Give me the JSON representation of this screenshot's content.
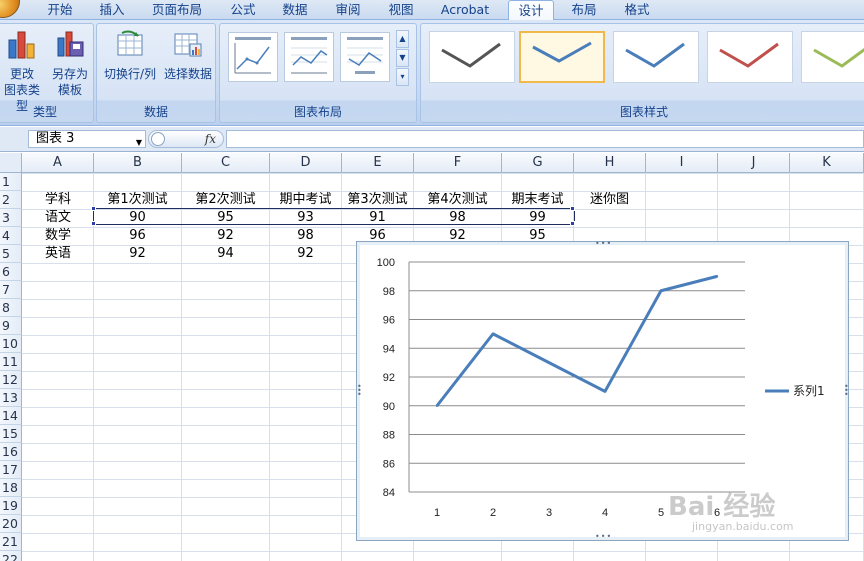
{
  "ribbon_tabs": [
    "开始",
    "插入",
    "页面布局",
    "公式",
    "数据",
    "审阅",
    "视图",
    "Acrobat",
    "设计",
    "布局",
    "格式"
  ],
  "active_tab": "设计",
  "ribbon": {
    "type_group": {
      "label": "类型",
      "change_type": [
        "更改",
        "图表类型"
      ],
      "save_template": [
        "另存为",
        "模板"
      ]
    },
    "data_group": {
      "label": "数据",
      "switch_row_col": "切换行/列",
      "select_data": "选择数据"
    },
    "layout_group": {
      "label": "图表布局"
    },
    "style_group": {
      "label": "图表样式"
    }
  },
  "formula_bar": {
    "name_box": "图表 3",
    "fx_label": "fx",
    "formula": ""
  },
  "columns": [
    "A",
    "B",
    "C",
    "D",
    "E",
    "F",
    "G",
    "H",
    "I",
    "J",
    "K"
  ],
  "rows": [
    "1",
    "2",
    "3",
    "4",
    "5",
    "6",
    "7",
    "8",
    "9",
    "10",
    "11",
    "12",
    "13",
    "14",
    "15",
    "16",
    "17",
    "18",
    "19",
    "20",
    "21",
    "22"
  ],
  "sheet": {
    "headers": [
      "学科",
      "第1次测试",
      "第2次测试",
      "期中考试",
      "第3次测试",
      "第4次测试",
      "期末考试",
      "迷你图"
    ],
    "rows": [
      {
        "subject": "语文",
        "scores": [
          "90",
          "95",
          "93",
          "91",
          "98",
          "99"
        ]
      },
      {
        "subject": "数学",
        "scores": [
          "96",
          "92",
          "98",
          "96",
          "92",
          "95"
        ]
      },
      {
        "subject": "英语",
        "scores": [
          "92",
          "94",
          "92",
          "",
          "",
          ""
        ]
      }
    ]
  },
  "chart_data": {
    "type": "line",
    "x": [
      1,
      2,
      3,
      4,
      5,
      6
    ],
    "series": [
      {
        "name": "系列1",
        "values": [
          90,
          95,
          93,
          91,
          98,
          99
        ],
        "color": "#4a7ebb"
      }
    ],
    "ylim": [
      84,
      100
    ],
    "yticks": [
      84,
      86,
      88,
      90,
      92,
      94,
      96,
      98,
      100
    ],
    "grid": true,
    "legend": "right"
  },
  "watermark": {
    "text": "Bai 经验",
    "sub": "jingyan.baidu.com"
  },
  "colors": {
    "accent": "#15428b",
    "series": "#4a7ebb",
    "selection_border": "#1e2c5e"
  }
}
